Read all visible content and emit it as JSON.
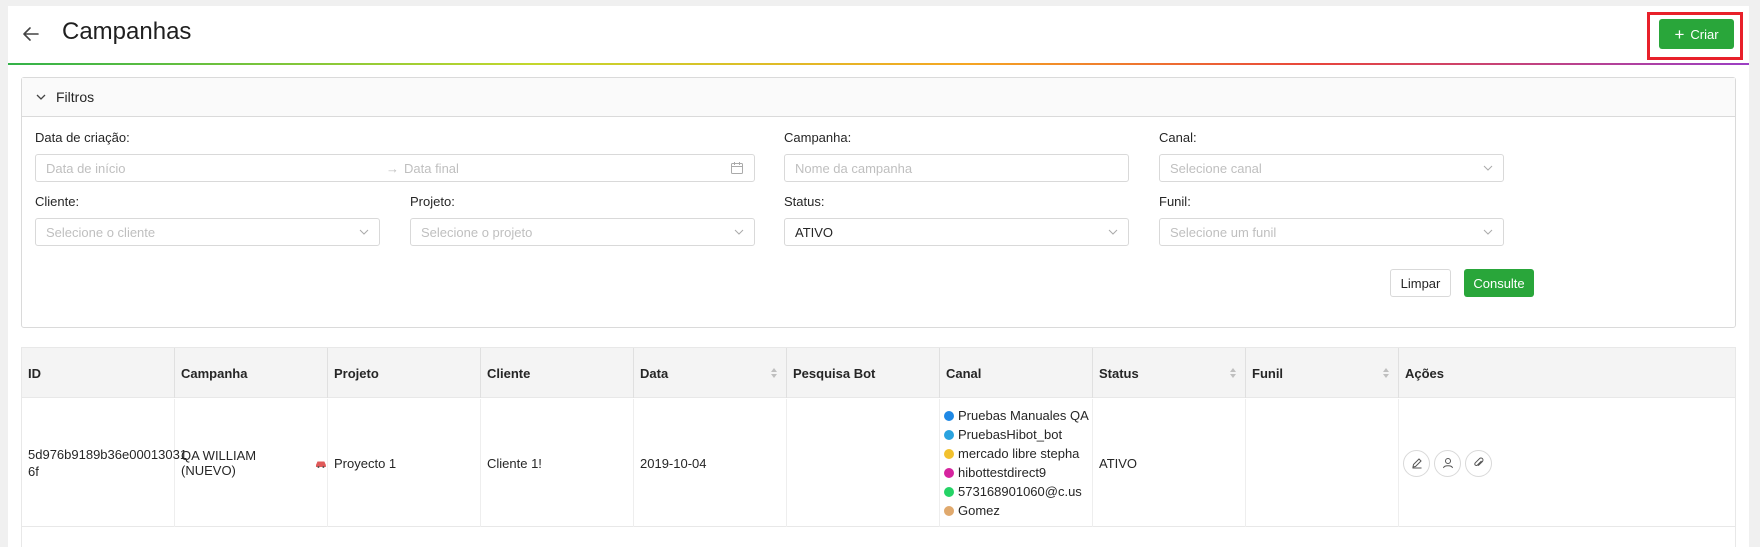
{
  "header": {
    "title": "Campanhas",
    "create_label": "Criar"
  },
  "filters": {
    "title": "Filtros",
    "date_label": "Data de criação",
    "date_start_placeholder": "Data de início",
    "date_end_placeholder": "Data final",
    "campaign_label": "Campanha",
    "campaign_placeholder": "Nome da campanha",
    "channel_label": "Canal",
    "channel_placeholder": "Selecione canal",
    "client_label": "Cliente",
    "client_placeholder": "Selecione o cliente",
    "project_label": "Projeto",
    "project_placeholder": "Selecione o projeto",
    "status_label": "Status",
    "status_value": "ATIVO",
    "funnel_label": "Funil",
    "funnel_placeholder": "Selecione um funil",
    "clear_label": "Limpar",
    "query_label": "Consulte"
  },
  "table": {
    "columns": [
      "ID",
      "Campanha",
      "Projeto",
      "Cliente",
      "Data",
      "Pesquisa Bot",
      "Canal",
      "Status",
      "Funil",
      "Ações"
    ],
    "rows": [
      {
        "id_line1": "5d976b9189b36e00013031",
        "id_line2": "6f",
        "campaign": "QA WILLIAM (NUEVO)",
        "project": "Proyecto 1",
        "client": "Cliente 1!",
        "date": "2019-10-04",
        "bot": "",
        "channels": [
          {
            "icon": "messenger-icon",
            "color": "#1e88e5",
            "label": "Pruebas Manuales QA"
          },
          {
            "icon": "telegram-icon",
            "color": "#2aa3df",
            "label": "PruebasHibot_bot"
          },
          {
            "icon": "mercadolibre-icon",
            "color": "#f2c12e",
            "label": "mercado libre stepha"
          },
          {
            "icon": "instagram-icon",
            "color": "#d6249f",
            "label": "hibottestdirect9"
          },
          {
            "icon": "whatsapp-icon",
            "color": "#25d366",
            "label": "573168901060@c.us"
          },
          {
            "icon": "hand-icon",
            "color": "#e0a96d",
            "label": "Gomez"
          }
        ],
        "status": "ATIVO",
        "funnel": ""
      }
    ]
  },
  "colors": {
    "primary_green": "#29a63a",
    "highlight_red": "#e8202a"
  }
}
